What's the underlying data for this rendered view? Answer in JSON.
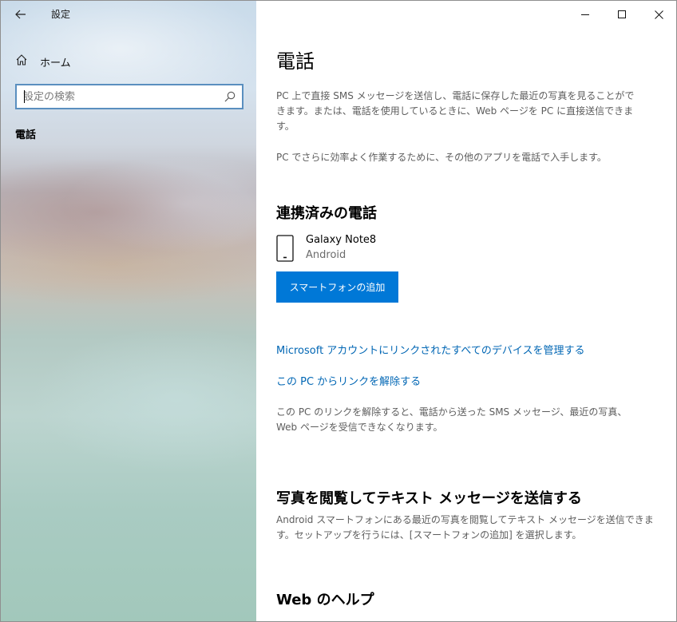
{
  "window": {
    "title": "設定",
    "controls": {
      "minimize_icon": "minimize-icon",
      "maximize_icon": "maximize-icon",
      "close_icon": "close-icon"
    }
  },
  "sidebar": {
    "back_icon": "back-arrow-icon",
    "home_label": "ホーム",
    "search": {
      "placeholder": "設定の検索",
      "value": ""
    },
    "current_item": "電話"
  },
  "main": {
    "title": "電話",
    "intro_1": "PC 上で直接 SMS メッセージを送信し、電話に保存した最近の写真を見ることができます。または、電話を使用しているときに、Web ページを PC に直接送信できます。",
    "intro_2": "PC でさらに効率よく作業するために、その他のアプリを電話で入手します。",
    "linked_section": {
      "title": "連携済みの電話",
      "device": {
        "name": "Galaxy Note8",
        "os": "Android"
      },
      "add_button": "スマートフォンの追加",
      "manage_link": "Microsoft アカウントにリンクされたすべてのデバイスを管理する",
      "unlink_link": "この PC からリンクを解除する",
      "unlink_note": "この PC のリンクを解除すると、電話から送った SMS メッセージ、最近の写真、Web ページを受信できなくなります。"
    },
    "photos_section": {
      "title": "写真を閲覧してテキスト メッセージを送信する",
      "description": "Android スマートフォンにある最近の写真を閲覧してテキスト メッセージを送信できます。セットアップを行うには、[スマートフォンの追加] を選択します。"
    },
    "help_section": {
      "title": "Web のヘルプ"
    }
  },
  "colors": {
    "accent": "#0078d7",
    "link": "#0066b4",
    "body_text": "#5d5d5d"
  }
}
